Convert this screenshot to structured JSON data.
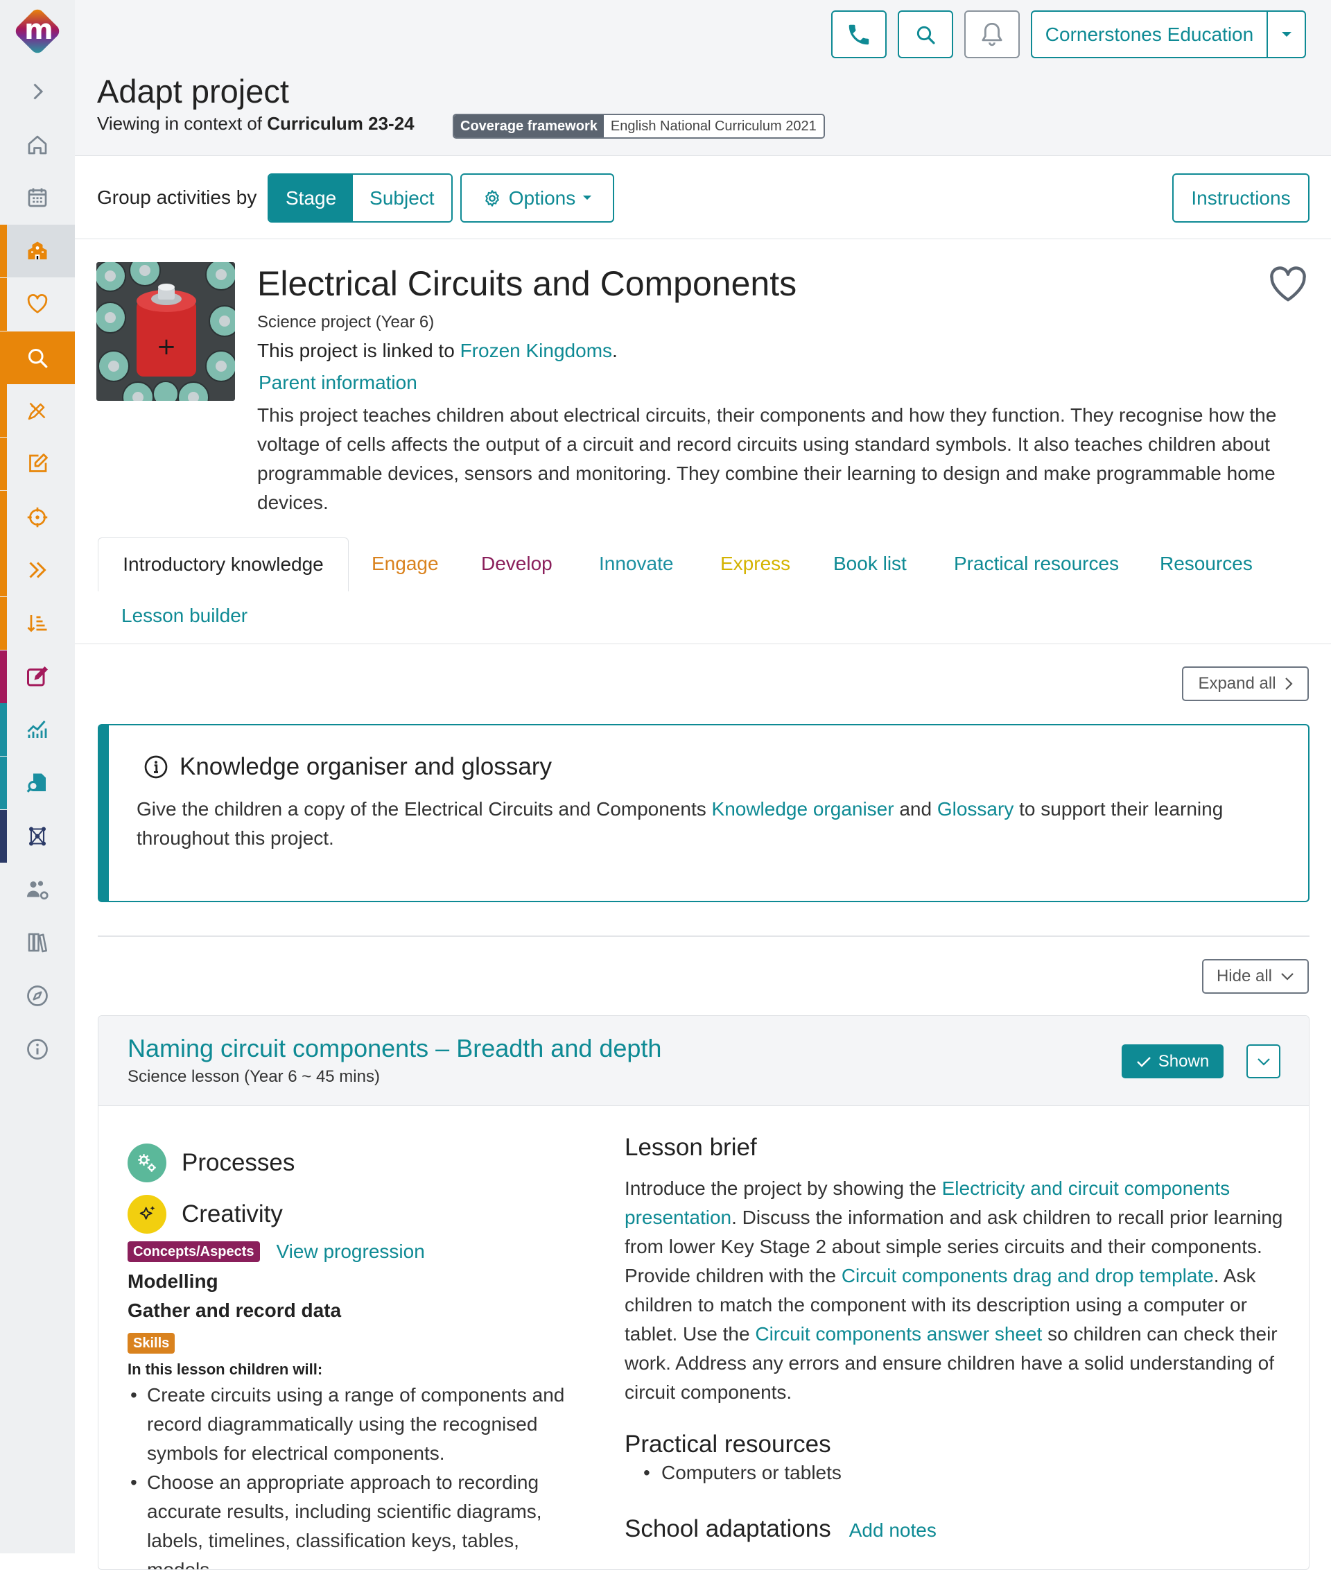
{
  "header": {
    "title": "Adapt project",
    "context_prefix": "Viewing in context of",
    "context_value": "Curriculum 23-24",
    "coverage_key": "Coverage framework",
    "coverage_value": "English National Curriculum 2021",
    "org_name": "Cornerstones Education",
    "icons": [
      "phone-icon",
      "search-icon",
      "bell-icon",
      "caret-down-icon"
    ]
  },
  "sidebar": {
    "logo_letter": "m",
    "items": [
      {
        "icon": "chevron-right-icon",
        "bar": "",
        "bg": ""
      },
      {
        "icon": "home-icon",
        "bar": "",
        "bg": ""
      },
      {
        "icon": "calendar-icon",
        "bar": "",
        "bg": ""
      },
      {
        "icon": "school-icon",
        "bar": "#e8860a",
        "bg": "#d9dde1"
      },
      {
        "icon": "heart-icon",
        "bar": "#e8860a",
        "bg": ""
      },
      {
        "icon": "search-icon",
        "bar": "#e8860a",
        "bg": "#e8860a"
      },
      {
        "icon": "pencil-ruler-icon",
        "bar": "#e8860a",
        "bg": ""
      },
      {
        "icon": "edit-icon",
        "bar": "#e8860a",
        "bg": ""
      },
      {
        "icon": "crosshair-icon",
        "bar": "#e8860a",
        "bg": ""
      },
      {
        "icon": "double-chevron-icon",
        "bar": "#e8860a",
        "bg": ""
      },
      {
        "icon": "sort-icon",
        "bar": "#e8860a",
        "bg": ""
      },
      {
        "icon": "pen-square-icon",
        "bar": "#a3195b",
        "bg": ""
      },
      {
        "icon": "chart-icon",
        "bar": "#1a8fa0",
        "bg": ""
      },
      {
        "icon": "file-search-icon",
        "bar": "#1a8fa0",
        "bg": ""
      },
      {
        "icon": "network-icon",
        "bar": "#2b3a67",
        "bg": ""
      },
      {
        "icon": "users-gear-icon",
        "bar": "",
        "bg": ""
      },
      {
        "icon": "books-icon",
        "bar": "",
        "bg": ""
      },
      {
        "icon": "compass-icon",
        "bar": "",
        "bg": ""
      },
      {
        "icon": "info-icon",
        "bar": "",
        "bg": ""
      }
    ]
  },
  "toolbar": {
    "group_label": "Group activities by",
    "stage": "Stage",
    "subject": "Subject",
    "options": "Options",
    "instructions": "Instructions"
  },
  "project": {
    "title": "Electrical Circuits and Components",
    "subtitle": "Science project (Year 6)",
    "linked_prefix": "This project is linked to",
    "linked_project": "Frozen Kingdoms",
    "linked_suffix": ".",
    "parent_info": "Parent information",
    "description": "This project teaches children about electrical circuits, their components and how they function. They recognise how the voltage of cells affects the output of a circuit and record circuits using standard symbols. It also teaches children about programmable devices, sensors and monitoring. They combine their learning to design and make programmable home devices."
  },
  "tabs": [
    {
      "label": "Introductory knowledge",
      "color": "#222222"
    },
    {
      "label": "Engage",
      "color": "#d9821e"
    },
    {
      "label": "Develop",
      "color": "#8a1f5b"
    },
    {
      "label": "Innovate",
      "color": "#1a8fa0"
    },
    {
      "label": "Express",
      "color": "#d4b300"
    },
    {
      "label": "Book list",
      "color": "#0e8a94"
    },
    {
      "label": "Practical resources",
      "color": "#0e8a94"
    },
    {
      "label": "Resources",
      "color": "#0e8a94"
    },
    {
      "label": "Lesson builder",
      "color": "#0e8a94"
    }
  ],
  "knowledge": {
    "expand_all": "Expand all",
    "title": "Knowledge organiser and glossary",
    "text_before": "Give the children a copy of the Electrical Circuits and Components",
    "link1": "Knowledge organiser",
    "mid": "and",
    "link2": "Glossary",
    "text_after": "to support their learning throughout this project."
  },
  "lesson": {
    "hide_all": "Hide all",
    "title": "Naming circuit components – Breadth and depth",
    "subtitle": "Science lesson (Year 6 ~ 45 mins)",
    "shown": "Shown",
    "disciplines": [
      {
        "label": "Processes",
        "color": "#5bb89a",
        "icon": "gears-icon"
      },
      {
        "label": "Creativity",
        "color": "#f2cf0f",
        "icon": "sparkle-icon"
      }
    ],
    "concepts_badge": "Concepts/Aspects",
    "concepts_color": "#8a1f5b",
    "view_progression": "View progression",
    "concepts": [
      "Modelling",
      "Gather and record data"
    ],
    "skills_badge": "Skills",
    "skills_color": "#d9821e",
    "will_label": "In this lesson children will:",
    "outcomes": [
      "Create circuits using a range of components and record diagrammatically using the recognised symbols for electrical components.",
      "Choose an appropriate approach to recording accurate results, including scientific diagrams, labels, timelines, classification keys, tables, models"
    ],
    "brief_title": "Lesson brief",
    "brief": {
      "t1": "Introduce the project by showing the",
      "l1": "Electricity and circuit components presentation",
      "t2": ". Discuss the information and ask children to recall prior learning from lower Key Stage 2 about simple series circuits and their components. Provide children with the",
      "l2": "Circuit components drag and drop template",
      "t3": ". Ask children to match the component with its description using a computer or tablet. Use the",
      "l3": "Circuit components answer sheet",
      "t4": "so children can check their work. Address any errors and ensure children have a solid understanding of circuit components."
    },
    "practical_title": "Practical resources",
    "practical_items": [
      "Computers or tablets"
    ],
    "adaptations_title": "School adaptations",
    "add_notes": "Add notes"
  },
  "colors": {
    "accent": "#0e8a94",
    "orange": "#e8860a"
  }
}
